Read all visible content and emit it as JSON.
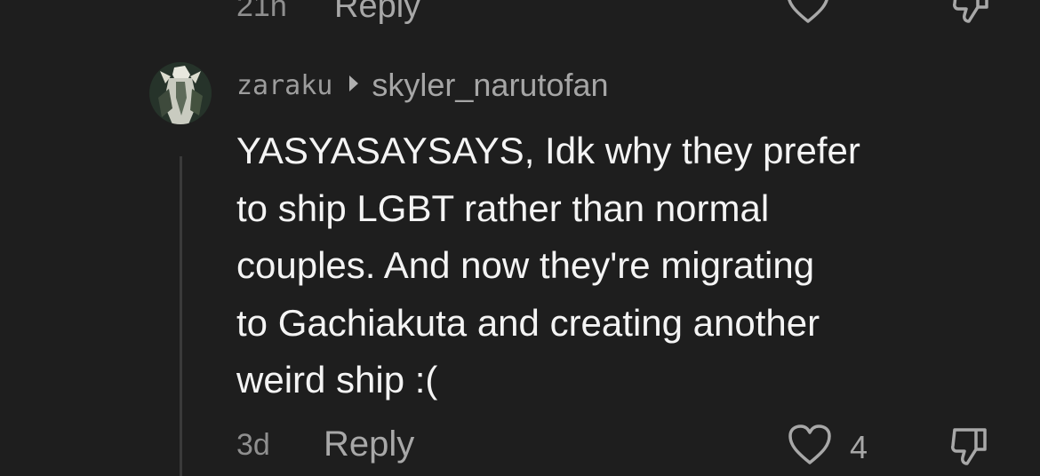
{
  "previous_comment": {
    "time": "21h",
    "reply_label": "Reply"
  },
  "comment": {
    "username": "zaraku",
    "reply_to": "skyler_narutofan",
    "text": "YASYASAYSAYS, Idk why they prefer\nto ship LGBT rather than normal\ncouples. And now they're migrating\nto Gachiakuta and creating another\nweird ship :(",
    "time": "3d",
    "reply_label": "Reply",
    "like_count": "4"
  },
  "icons": {
    "like": "heart-icon",
    "dislike": "thumbs-down-icon",
    "reply_to": "caret-right-icon"
  },
  "colors": {
    "background": "#1e1e1e",
    "text": "#f4f4f4",
    "muted": "#a8a8a8",
    "thread_line": "#3a3a3a"
  }
}
